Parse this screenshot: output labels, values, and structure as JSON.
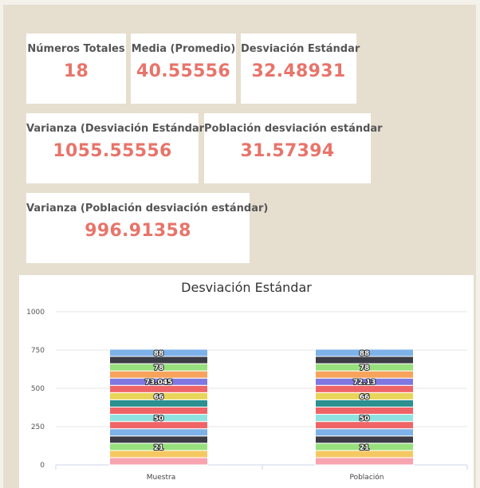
{
  "stats": {
    "total_count": {
      "label": "Números Totales",
      "value": "18"
    },
    "mean": {
      "label": "Media (Promedio)",
      "value": "40.55556"
    },
    "std_dev": {
      "label": "Desviación Estándar",
      "value": "32.48931"
    },
    "variance": {
      "label": "Varianza (Desviación Estándar)",
      "value": "1055.55556"
    },
    "population_std_dev": {
      "label": "Población desviación estándar",
      "value": "31.57394"
    },
    "population_variance": {
      "label": "Varianza (Población desviación estándar)",
      "value": "996.91358"
    }
  },
  "chart_data": {
    "type": "bar",
    "stacked": true,
    "title": "Desviación Estándar",
    "categories": [
      "Muestra",
      "Población"
    ],
    "ylim": [
      0,
      1000
    ],
    "y_ticks": [
      0,
      250,
      500,
      750,
      1000
    ],
    "grid": true,
    "segment_height": 47.22,
    "colors": [
      "#f7a3b0",
      "#f5c862",
      "#97e07c",
      "#3b3c45",
      "#7db1e8",
      "#ef6567",
      "#8ee3e0",
      "#ef6567",
      "#2b908f",
      "#e8d55a",
      "#ef6567",
      "#7f78e0",
      "#f7a35c",
      "#97e07c",
      "#3b3c45",
      "#7db1e8"
    ],
    "segments_muestra": [
      "",
      "",
      "21",
      "",
      "",
      "",
      "50",
      "",
      "",
      "66",
      "",
      "73.045",
      "",
      "78",
      "",
      "88"
    ],
    "segments_poblacion": [
      "",
      "",
      "21",
      "",
      "",
      "",
      "50",
      "",
      "",
      "66",
      "",
      "72.13",
      "",
      "78",
      "",
      "88"
    ],
    "segment_values": [
      0,
      0,
      21,
      0,
      0,
      0,
      50,
      0,
      0,
      66,
      0,
      73.045,
      0,
      78,
      0,
      88
    ]
  }
}
